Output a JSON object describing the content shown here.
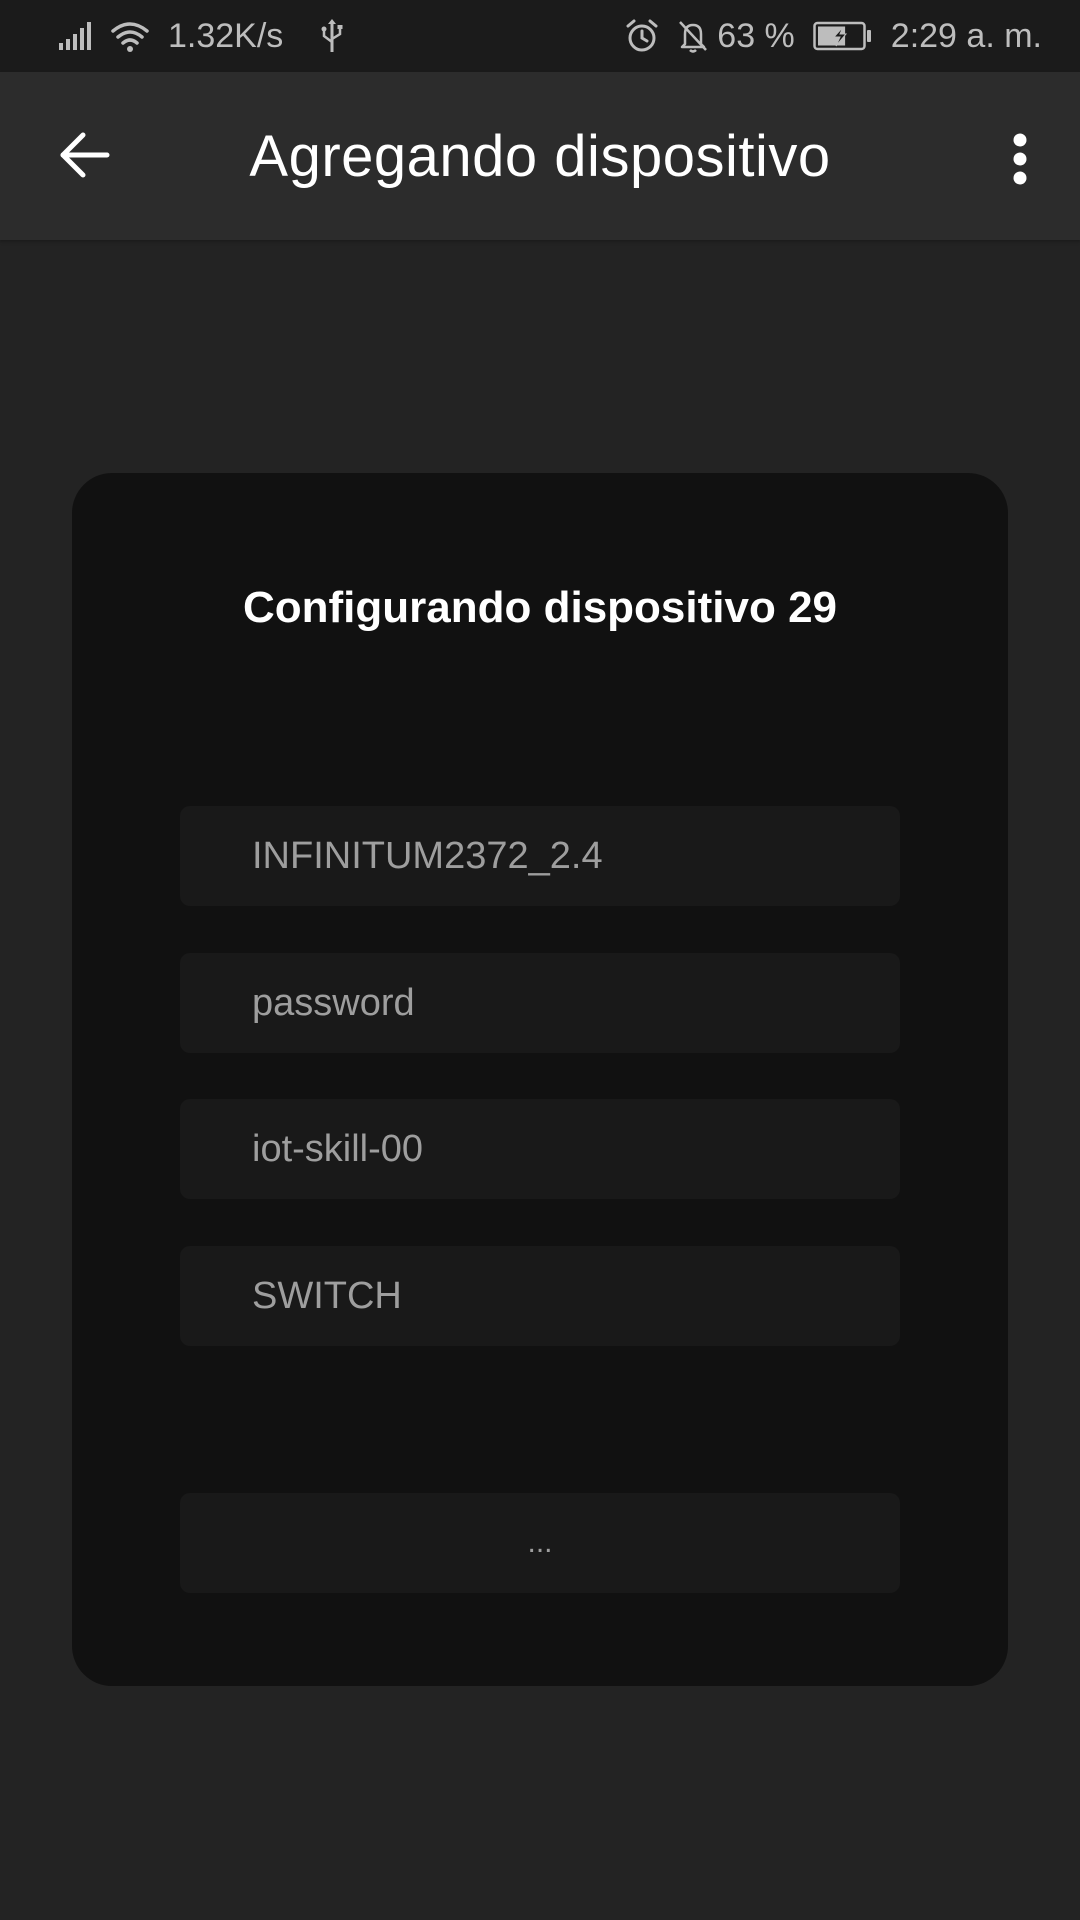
{
  "status_bar": {
    "network_speed": "1.32K/s",
    "battery_percent": "63 %",
    "time": "2:29 a. m.",
    "icons": [
      "signal-icon",
      "wifi-icon",
      "usb-icon",
      "alarm-icon",
      "notifications-off-icon",
      "battery-charging-icon"
    ],
    "battery_level": 0.63
  },
  "app_bar": {
    "title": "Agregando dispositivo",
    "back_icon": "arrow-back-icon",
    "menu_icon": "more-vert-icon"
  },
  "card": {
    "title": "Configurando dispositivo 29",
    "fields": {
      "ssid": "INFINITUM2372_2.4",
      "password": "password",
      "skill": "iot-skill-00",
      "type": "SWITCH"
    },
    "submit_label": "..."
  },
  "colors": {
    "background": "#232323",
    "status_bar": "#1b1b1b",
    "app_bar": "#2c2c2c",
    "card": "#111111",
    "field": "#191919",
    "field_text": "#9e9e9e",
    "title_text": "#ffffff"
  }
}
